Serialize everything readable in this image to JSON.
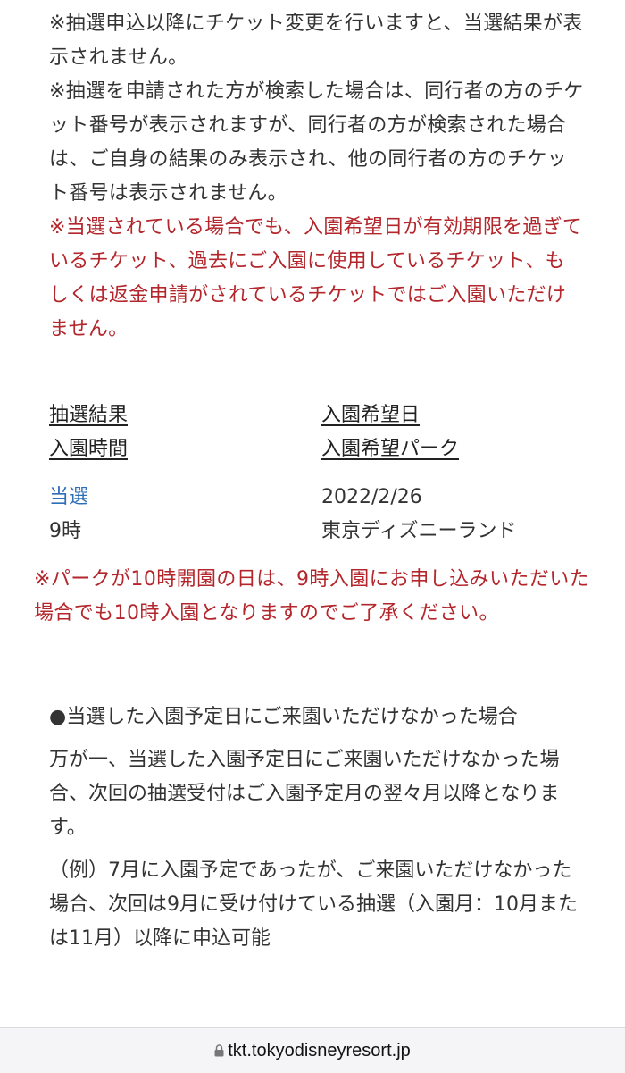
{
  "notes": [
    {
      "text": "※抽選申込以降にチケット変更を行いますと、当選結果が表示されません。",
      "color": "#333333"
    },
    {
      "text": "※抽選を申請された方が検索した場合は、同行者の方のチケット番号が表示されますが、同行者の方が検索された場合は、ご自身の結果のみ表示され、他の同行者の方のチケット番号は表示されません。",
      "color": "#333333"
    },
    {
      "text": "※当選されている場合でも、入園希望日が有効期限を過ぎているチケット、過去にご入園に使用しているチケット、もしくは返金申請がされているチケットではご入園いただけません。",
      "color": "#b3262b"
    }
  ],
  "result": {
    "header_result": "抽選結果",
    "header_time": "入園時間",
    "header_date": "入園希望日",
    "header_park": "入園希望パーク",
    "value_result": "当選",
    "value_time": "9時",
    "value_date": "2022/2/26",
    "value_park": "東京ディズニーランド"
  },
  "time_note": "※パークが10時開園の日は、9時入園にお申し込みいただいた場合でも10時入園となりますのでご了承ください。",
  "absence_section": {
    "heading": "●当選した入園予定日にご来園いただけなかった場合",
    "body": "万が一、当選した入園予定日にご来園いただけなかった場合、次回の抽選受付はご入園予定月の翌々月以降となります。",
    "example": "（例）7月に入園予定であったが、ご来園いただけなかった場合、次回は9月に受け付けている抽選（入園月：10月または11月）以降に申込可能"
  },
  "browser": {
    "url": "tkt.tokyodisneyresort.jp",
    "icon": "lock-icon"
  },
  "colors": {
    "text": "#333333",
    "warning_red": "#b3262b",
    "win_blue": "#2f6fb7"
  }
}
